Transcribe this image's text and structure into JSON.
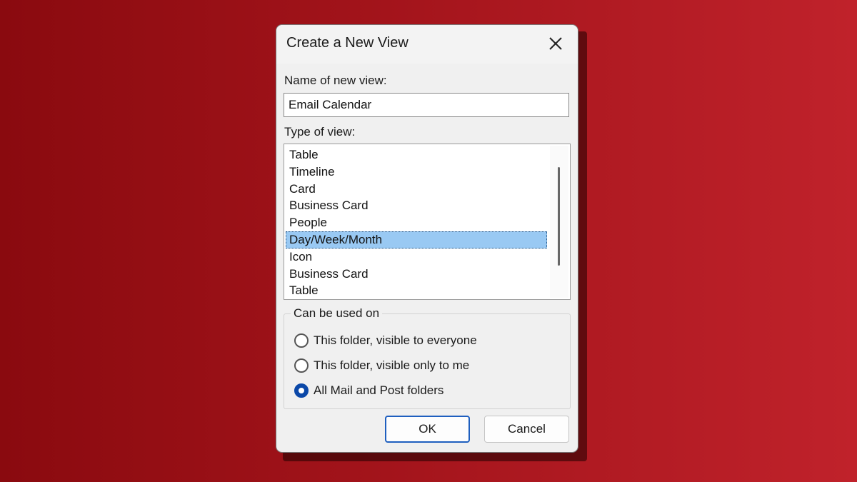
{
  "dialog": {
    "title": "Create a New View",
    "name_label": "Name of new view:",
    "name_value": "Email Calendar",
    "type_label": "Type of view:",
    "view_types": [
      "Table",
      "Timeline",
      "Card",
      "Business Card",
      "People",
      "Day/Week/Month",
      "Icon",
      "Business Card",
      "Table"
    ],
    "selected_view_type": "Day/Week/Month",
    "group_label": "Can be used on",
    "options": [
      {
        "label": "This folder, visible to everyone",
        "checked": false
      },
      {
        "label": "This folder, visible only to me",
        "checked": false
      },
      {
        "label": "All Mail and Post folders",
        "checked": true
      }
    ],
    "ok_label": "OK",
    "cancel_label": "Cancel"
  },
  "colors": {
    "background": "#a3141b",
    "selection": "#99c9f3",
    "radio_checked": "#0b48a8",
    "default_button_border": "#1f5fbf"
  },
  "icons": {
    "close": "close-icon"
  }
}
